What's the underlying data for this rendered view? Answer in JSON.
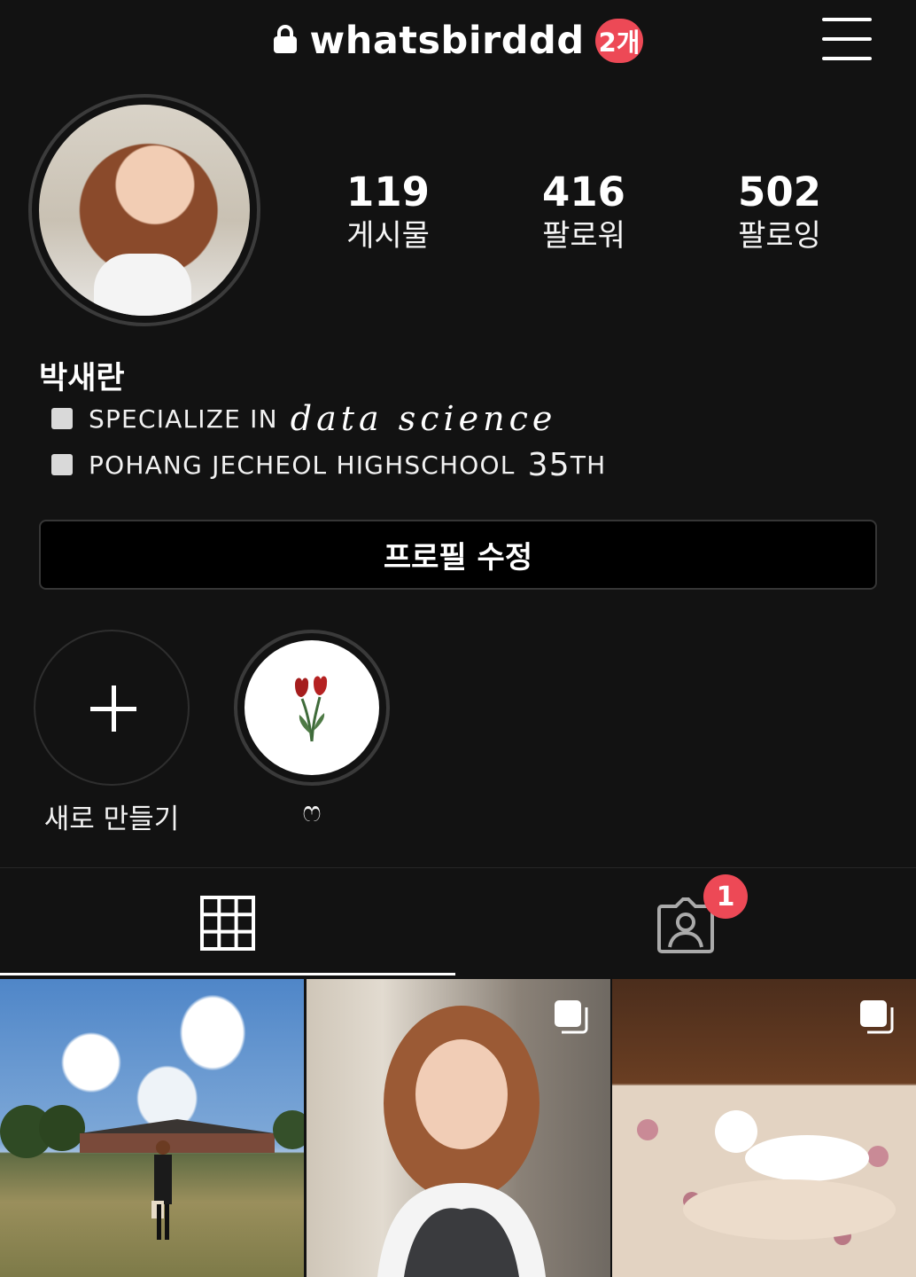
{
  "header": {
    "username": "whatsbirddd",
    "account_badge": "2개",
    "lock_icon": "lock-icon",
    "menu_icon": "hamburger-menu-icon"
  },
  "profile": {
    "name": "박새란",
    "bio": [
      {
        "text": "SPECIALIZE IN",
        "script": "data science"
      },
      {
        "text": "POHANG JECHEOL HIGHSCHOOL",
        "big": "35",
        "suffix": "TH"
      }
    ]
  },
  "stats": [
    {
      "value": "119",
      "label": "게시물"
    },
    {
      "value": "416",
      "label": "팔로워"
    },
    {
      "value": "502",
      "label": "팔로잉"
    }
  ],
  "edit_profile_label": "프로필 수정",
  "highlights": [
    {
      "label": "새로 만들기",
      "icon": "plus-icon"
    },
    {
      "label": "ෆ",
      "icon": "tulip-icon"
    }
  ],
  "tabs": {
    "grid_icon": "grid-icon",
    "tagged_icon": "tagged-person-icon",
    "tagged_badge": "1"
  },
  "posts": [
    {
      "alt": "photo",
      "multi": false
    },
    {
      "alt": "photo",
      "multi": true
    },
    {
      "alt": "photo",
      "multi": true
    }
  ],
  "colors": {
    "background": "#121212",
    "badge": "#ed4956"
  }
}
